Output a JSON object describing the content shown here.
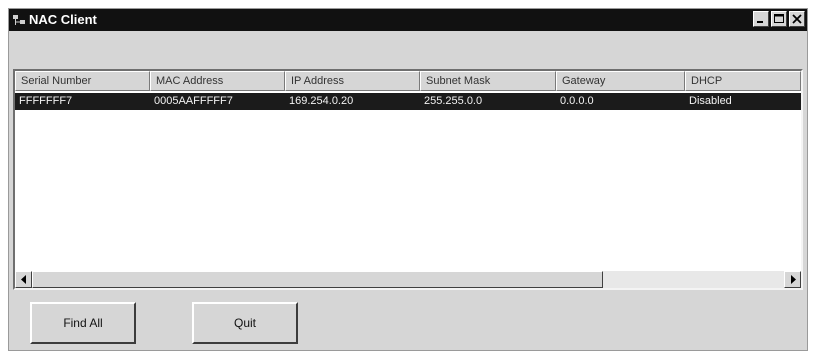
{
  "window": {
    "title": "NAC Client",
    "icon": "app-network-icon",
    "buttons": [
      "minimize-icon",
      "maximize-icon",
      "close-icon"
    ]
  },
  "list": {
    "columns": [
      "Serial Number",
      "MAC Address",
      "IP Address",
      "Subnet Mask",
      "Gateway",
      "DHCP"
    ],
    "rows": [
      {
        "cells": [
          "FFFFFFF7",
          "0005AAFFFFF7",
          "169.254.0.20",
          "255.255.0.0",
          "0.0.0.0",
          "Disabled"
        ],
        "selected": true
      }
    ]
  },
  "buttons": {
    "find_all": "Find All",
    "quit": "Quit"
  },
  "colors": {
    "titlebar": "#111111",
    "selection": "#1b1b1b",
    "face": "#d6d6d6"
  }
}
